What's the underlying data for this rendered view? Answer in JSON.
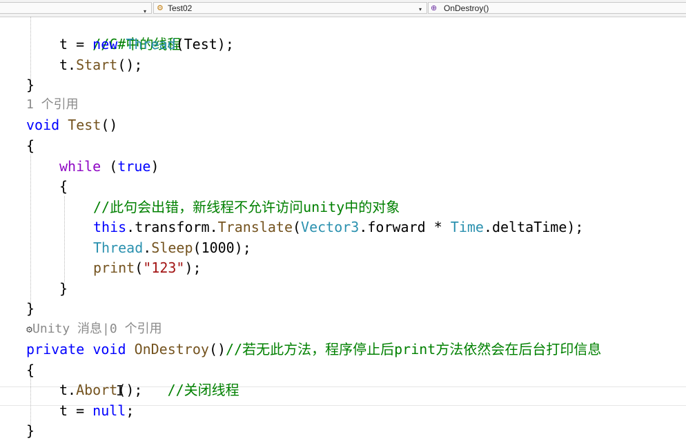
{
  "navbar": {
    "left_arrow": "▾",
    "member_icon": "⚙",
    "class_name": "Test02",
    "class_arrow": "▾",
    "method_icon": "⊕",
    "method_name": "OnDestroy()"
  },
  "code": {
    "l1_comment": "//C#中的线程",
    "l2_a": "t = ",
    "l2_new": "new",
    "l2_sp": " ",
    "l2_type": "Thread",
    "l2_b": "(Test);",
    "l3_a": "t.",
    "l3_fn": "Start",
    "l3_b": "();",
    "l4": "}",
    "ref1": "1 个引用",
    "l6_void": "void",
    "l6_sp": " ",
    "l6_fn": "Test",
    "l6_b": "()",
    "l7": "{",
    "l8_while": "while",
    "l8_a": " (",
    "l8_true": "true",
    "l8_b": ")",
    "l9": "{",
    "l10_comment": "//此句会出错，新线程不允许访问unity中的对象",
    "l11_this": "this",
    "l11_a": ".transform.",
    "l11_fn": "Translate",
    "l11_b": "(",
    "l11_ty": "Vector3",
    "l11_c": ".forward * ",
    "l11_ty2": "Time",
    "l11_d": ".deltaTime);",
    "l12_ty": "Thread",
    "l12_a": ".",
    "l12_fn": "Sleep",
    "l12_b": "(",
    "l12_num": "1000",
    "l12_c": ");",
    "l13_fn": "print",
    "l13_a": "(",
    "l13_str": "\"123\"",
    "l13_b": ");",
    "l14": "}",
    "l15": "}",
    "ref2": "Unity 消息|0 个引用",
    "ref2_icon": "⚙",
    "l17_private": "private",
    "l17_sp": " ",
    "l17_void": "void",
    "l17_sp2": " ",
    "l17_fn": "OnDestroy",
    "l17_a": "()",
    "l17_comment": "//若无此方法，程序停止后print方法依然会在后台打印信息",
    "l18": "{",
    "l19_a": "t.",
    "l19_fn": "Abort",
    "l19_b": "();   ",
    "l19_comment": "//关闭线程",
    "l20_a": "t = ",
    "l20_null": "null",
    "l20_b": ";",
    "l21": "}"
  }
}
